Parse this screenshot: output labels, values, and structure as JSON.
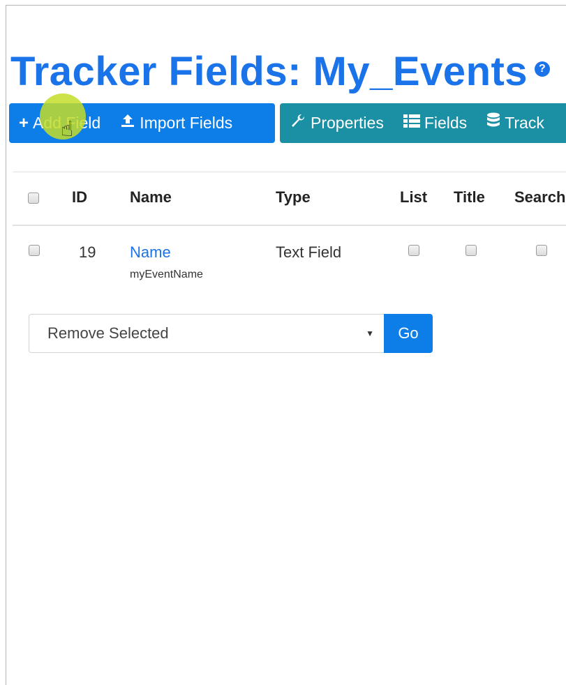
{
  "page": {
    "title": "Tracker Fields: My_Events",
    "help_icon": "question-circle-icon"
  },
  "toolbar": {
    "primary": [
      {
        "icon": "plus-icon",
        "label": "Add Field"
      },
      {
        "icon": "upload-icon",
        "label": "Import Fields"
      }
    ],
    "secondary": [
      {
        "icon": "wrench-icon",
        "label": "Properties"
      },
      {
        "icon": "list-icon",
        "label": "Fields"
      },
      {
        "icon": "database-icon",
        "label": "Track"
      }
    ]
  },
  "table": {
    "headers": {
      "id": "ID",
      "name": "Name",
      "type": "Type",
      "list": "List",
      "title": "Title",
      "search": "Search"
    },
    "rows": [
      {
        "id": "19",
        "name": "Name",
        "perm_name": "myEventName",
        "type": "Text Field",
        "list": false,
        "title": false,
        "search": false
      }
    ]
  },
  "bulk_action": {
    "selected": "Remove Selected",
    "go_label": "Go"
  },
  "colors": {
    "title": "#1a73e8",
    "primary_button": "#0d7de8",
    "secondary_button": "#1b8fa3",
    "cursor_highlight": "#c4dc28"
  }
}
